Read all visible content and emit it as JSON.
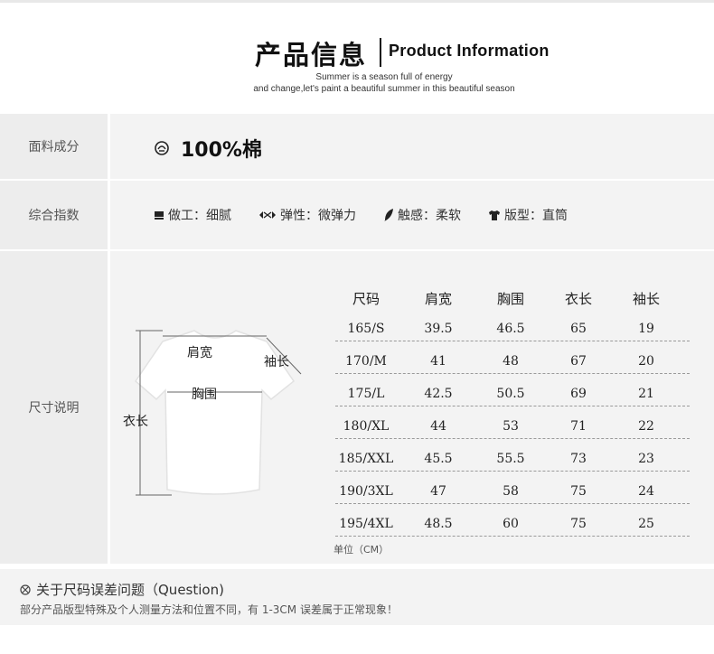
{
  "header": {
    "title_cn": "产品信息",
    "title_en": "Product Information",
    "subtitle_line1": "Summer is a season full of energy",
    "subtitle_line2": "and change,let's paint a beautiful summer in this beautiful season"
  },
  "fabric": {
    "label": "面料成分",
    "icon": "cotton-icon",
    "value": "100%棉"
  },
  "indexes": {
    "label": "综合指数",
    "items": [
      {
        "icon": "craft-icon",
        "text": "做工：细腻"
      },
      {
        "icon": "elastic-icon",
        "text": "弹性：微弹力"
      },
      {
        "icon": "feather-icon",
        "text": "触感：柔软"
      },
      {
        "icon": "tshirt-icon",
        "text": "版型：直筒"
      }
    ]
  },
  "size": {
    "label": "尺寸说明",
    "shirt_labels": {
      "shoulder": "肩宽",
      "sleeve": "袖长",
      "chest": "胸围",
      "length": "衣长"
    },
    "headers": [
      "尺码",
      "肩宽",
      "胸围",
      "衣长",
      "袖长"
    ],
    "rows": [
      [
        "165/S",
        "39.5",
        "46.5",
        "65",
        "19"
      ],
      [
        "170/M",
        "41",
        "48",
        "67",
        "20"
      ],
      [
        "175/L",
        "42.5",
        "50.5",
        "69",
        "21"
      ],
      [
        "180/XL",
        "44",
        "53",
        "71",
        "22"
      ],
      [
        "185/XXL",
        "45.5",
        "55.5",
        "73",
        "23"
      ],
      [
        "190/3XL",
        "47",
        "58",
        "75",
        "24"
      ],
      [
        "195/4XL",
        "48.5",
        "60",
        "75",
        "25"
      ]
    ],
    "unit": "单位（CM）"
  },
  "notice": {
    "icon": "notice-icon",
    "title": "关于尺码误差问题（Question)",
    "text": "部分产品版型特殊及个人测量方法和位置不同，有 1-3CM 误差属于正常现象！"
  }
}
